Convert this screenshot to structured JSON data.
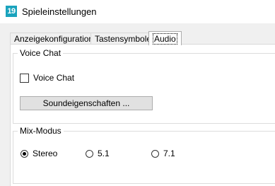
{
  "window": {
    "icon_text": "19",
    "title": "Spieleinstellungen"
  },
  "tabs": [
    {
      "label": "Anzeigekonfiguration",
      "active": false
    },
    {
      "label": "Tastensymbole",
      "active": false
    },
    {
      "label": "Audio",
      "active": true
    }
  ],
  "voice_chat_group": {
    "title": "Voice Chat",
    "checkbox_label": "Voice Chat",
    "checked": false,
    "sound_button_label": "Soundeigenschaften ..."
  },
  "mix_mode_group": {
    "title": "Mix-Modus",
    "options": [
      {
        "label": "Stereo",
        "selected": true
      },
      {
        "label": "5.1",
        "selected": false
      },
      {
        "label": "7.1",
        "selected": false
      }
    ]
  },
  "colors": {
    "app_icon": "#1aa3bd"
  }
}
